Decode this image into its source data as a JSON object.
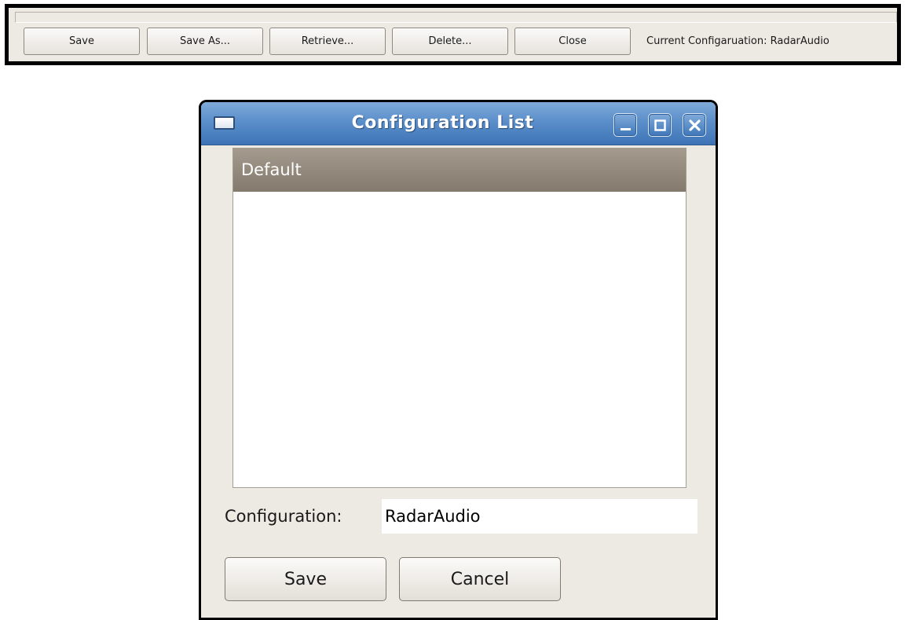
{
  "toolbar": {
    "buttons": [
      "Save",
      "Save As...",
      "Retrieve...",
      "Delete...",
      "Close"
    ],
    "status": "Current Configaruation: RadarAudio"
  },
  "dialog": {
    "title": "Configuration List",
    "title_icons": [
      "window-icon",
      "minimize-icon",
      "maximize-icon",
      "close-icon"
    ],
    "list": {
      "items": [
        "Default"
      ],
      "selected": "Default"
    },
    "config_label": "Configuration:",
    "config_value": "RadarAudio",
    "save_label": "Save",
    "cancel_label": "Cancel"
  },
  "colors": {
    "titlebar": "#4f84c2",
    "selection": "#948b7e",
    "background": "#ede9e3"
  }
}
